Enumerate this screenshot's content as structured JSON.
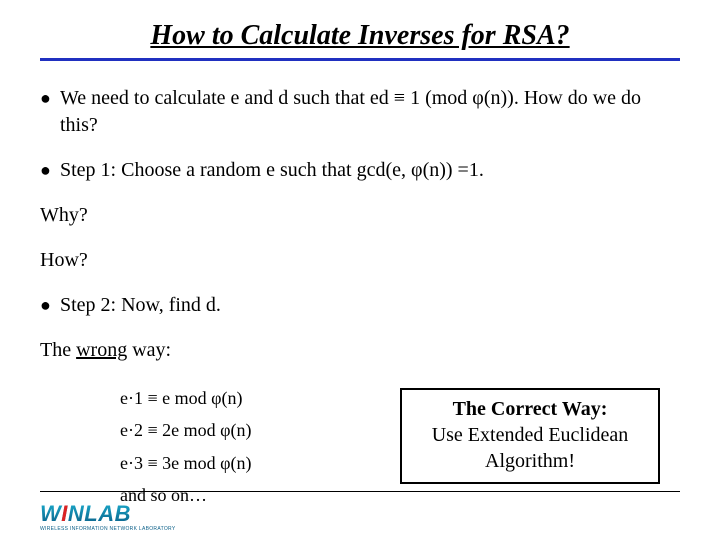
{
  "title": "How to Calculate Inverses for RSA?",
  "bullets": {
    "b1": "We need to calculate e and d such that ed ≡ 1 (mod φ(n)). How do we do this?",
    "b2": "Step 1: Choose a random e such that gcd(e, φ(n)) =1.",
    "b3": "Step 2: Now, find d."
  },
  "lines": {
    "why": "Why?",
    "how": "How?",
    "wrong_prefix": "The ",
    "wrong_word": "wrong",
    "wrong_suffix": " way:"
  },
  "math": {
    "r1": "e·1 ≡ e mod φ(n)",
    "r2": "e·2 ≡ 2e mod φ(n)",
    "r3": "e·3 ≡ 3e mod φ(n)",
    "r4": "and so on…"
  },
  "correct_box": {
    "title": "The Correct Way:",
    "line1": "Use Extended Euclidean",
    "line2": "Algorithm!"
  },
  "logo": {
    "text_pre": "W",
    "text_red": "I",
    "text_post": "NLAB",
    "sub": "WIRELESS INFORMATION NETWORK LABORATORY"
  }
}
